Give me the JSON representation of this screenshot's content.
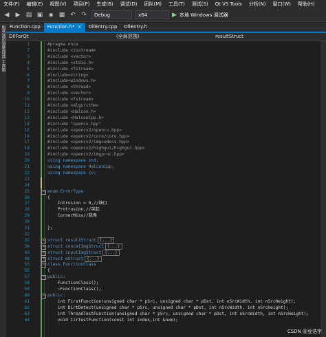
{
  "menu": [
    "文件(F)",
    "编辑(E)",
    "视图(V)",
    "项目(P)",
    "生成(B)",
    "调试(D)",
    "团队(M)",
    "工具(T)",
    "测试(S)",
    "Qt VS Tools",
    "分析(N)",
    "窗口(W)",
    "帮助(H)"
  ],
  "toolbar": {
    "config": "Debug",
    "platform": "x64",
    "run_label": "本地 Windows 调试器"
  },
  "side_tab": "服务器资源管理器 工具箱",
  "tabs": [
    {
      "label": "Function.cpp",
      "active": false
    },
    {
      "label": "Function.h*",
      "active": true
    },
    {
      "label": "DllEntry.cpp",
      "active": false
    },
    {
      "label": "DllEntry.h",
      "active": false
    }
  ],
  "navbar": {
    "project": "DllForQt",
    "scope": "(全局范围)",
    "member": "resultStruct"
  },
  "code_lines": [
    {
      "n": "1",
      "t": "#pragma once",
      "c": "pp"
    },
    {
      "n": "2",
      "t": "#include <iostream>",
      "c": "pp"
    },
    {
      "n": "3",
      "t": "#include <vector>",
      "c": "pp"
    },
    {
      "n": "4",
      "t": "#include <stdio.h>",
      "c": "pp"
    },
    {
      "n": "5",
      "t": "#include <fstream>",
      "c": "pp"
    },
    {
      "n": "6",
      "t": "#include<string>",
      "c": "pp"
    },
    {
      "n": "7",
      "t": "#include<windows.h>",
      "c": "pp"
    },
    {
      "n": "8",
      "t": "#include <thread>",
      "c": "pp"
    },
    {
      "n": "9",
      "t": "#include <vector>",
      "c": "pp"
    },
    {
      "n": "10",
      "t": "#include <fstream>",
      "c": "pp"
    },
    {
      "n": "11",
      "t": "#include <algorithm>",
      "c": "pp"
    },
    {
      "n": "12",
      "t": "#include <Halcon.h>",
      "c": "pp"
    },
    {
      "n": "13",
      "t": "#include <HalconCpp.h>",
      "c": "pp"
    },
    {
      "n": "14",
      "t": "#include \"opencv.hpp\"",
      "c": "pp"
    },
    {
      "n": "15",
      "t": "#include <opencv2/opencv.hpp>",
      "c": "pp"
    },
    {
      "n": "16",
      "t": "#include <opencv2/core/core.hpp>",
      "c": "pp"
    },
    {
      "n": "17",
      "t": "#include <opencv2/imgcodecs.hpp>",
      "c": "pp"
    },
    {
      "n": "18",
      "t": "#include <opencv2/highgui/highgui.hpp>",
      "c": "pp"
    },
    {
      "n": "19",
      "t": "#include <opencv2/imgproc.hpp>",
      "c": "pp"
    },
    {
      "n": "20",
      "t": "using namespace std;",
      "c": "kw"
    },
    {
      "n": "21",
      "t": "using namespace HalconCpp;",
      "c": "kw"
    },
    {
      "n": "22",
      "t": "using namespace cv;",
      "c": "kw"
    },
    {
      "n": "23",
      "t": "",
      "c": "plain"
    },
    {
      "n": "24",
      "t": "",
      "c": "plain"
    },
    {
      "n": "25",
      "t": "enum ErrorType",
      "c": "kw"
    },
    {
      "n": "26",
      "t": "{",
      "c": "plain"
    },
    {
      "n": "27",
      "t": "    Intrusion = 0,//缺口",
      "c": "plain"
    },
    {
      "n": "28",
      "t": "    Protrusion,//突起",
      "c": "plain"
    },
    {
      "n": "29",
      "t": "    CornerMiss//缺角",
      "c": "plain"
    },
    {
      "n": "30",
      "t": "",
      "c": "plain"
    },
    {
      "n": "31",
      "t": "};",
      "c": "plain"
    },
    {
      "n": "32",
      "t": "",
      "c": "plain"
    },
    {
      "n": "33",
      "t": "struct resultStruct",
      "c": "kw"
    },
    {
      "n": "36",
      "t": "struct concatImgStruct",
      "c": "kw"
    },
    {
      "n": "43",
      "t": "struct inputImgStruct",
      "c": "kw"
    },
    {
      "n": "48",
      "t": "struct mStruct",
      "c": "kw"
    },
    {
      "n": "55",
      "t": "class FunctionClass",
      "c": "kw"
    },
    {
      "n": "56",
      "t": "{",
      "c": "plain"
    },
    {
      "n": "57",
      "t": "public:",
      "c": "kw"
    },
    {
      "n": "58",
      "t": "    FunctionClass();",
      "c": "plain"
    },
    {
      "n": "59",
      "t": "    ~FunctionClass();",
      "c": "plain"
    },
    {
      "n": "60",
      "t": "public:",
      "c": "kw"
    },
    {
      "n": "61",
      "t": "    int FirstFunction(unsigned char * pSrc, unsigned char * pDst, int nSrcWidth, int nSrcHeight);",
      "c": "plain"
    },
    {
      "n": "62",
      "t": "    int DirtDetect(unsigned char * pSrc, unsigned char * pDst, int nSrcWidth, int nSrcHeight);",
      "c": "plain"
    },
    {
      "n": "63",
      "t": "    int ThreadTestFunction(unsigned char * pSrc, unsigned char * pDst, int nSrcWidth, int nSrcHeight);",
      "c": "plain"
    },
    {
      "n": "64",
      "t": "    void CirTestFunction(const int index,int &num);",
      "c": "plain"
    }
  ],
  "collapsed_placeholder": "{...}",
  "watermark": "CSDN @豆浩宇"
}
